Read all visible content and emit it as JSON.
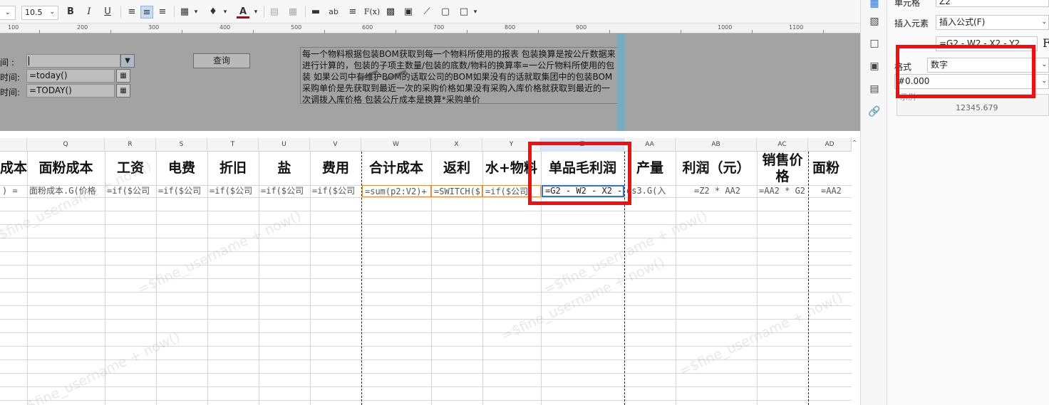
{
  "toolbar": {
    "font_size": "10.5",
    "bold": "B",
    "italic": "I",
    "underline": "U",
    "font_color_glyph": "A",
    "text_glyph": "ab",
    "formula_glyph": "F(x)"
  },
  "ruler": {
    "labels": [
      "100",
      "200",
      "300",
      "400",
      "500",
      "600",
      "700",
      "800",
      "900",
      "1000",
      "1100"
    ]
  },
  "params": {
    "label1": "间 :",
    "label2": "时间:",
    "label3": "时间:",
    "field1": "",
    "field2": "=today()",
    "field3": "=TODAY()",
    "query_button": "查询",
    "description": "每一个物料根据包装BOM获取到每一个物料所使用的报表  包装换算是按公斤数据来进行计算的，包装的子项主数量/包装的底数/物料的换算率=一公斤物料所使用的包装  如果公司中有维护BOM的话取公司的BOM如果没有的话就取集团中的包装BOM  采购单价是先获取到最近一次的采购价格如果没有采购入库价格就获取到最近的一次调拨入库价格  包装公斤成本是换算*采购单价"
  },
  "grid": {
    "columns": [
      {
        "letter": "",
        "header": "成本",
        "formula": ") ="
      },
      {
        "letter": "Q",
        "header": "面粉成本",
        "formula": "面粉成本.G(价格"
      },
      {
        "letter": "R",
        "header": "工资",
        "formula": "=if($公司"
      },
      {
        "letter": "S",
        "header": "电费",
        "formula": "=if($公司"
      },
      {
        "letter": "T",
        "header": "折旧",
        "formula": "=if($公司"
      },
      {
        "letter": "U",
        "header": "盐",
        "formula": "=if($公司"
      },
      {
        "letter": "V",
        "header": "费用",
        "formula": "=if($公司"
      },
      {
        "letter": "W",
        "header": "合计成本",
        "formula": "=sum(p2:V2)+"
      },
      {
        "letter": "X",
        "header": "返利",
        "formula": "=SWITCH($"
      },
      {
        "letter": "Y",
        "header": "水+物料",
        "formula": "=if($公司"
      },
      {
        "letter": "Z",
        "header": "单品毛利润",
        "formula": "=G2 - W2 - X2 -"
      },
      {
        "letter": "AA",
        "header": "产量",
        "formula": "ds3.G(入"
      },
      {
        "letter": "AB",
        "header": "利润（元）",
        "formula": "=Z2 * AA2"
      },
      {
        "letter": "AC",
        "header": "销售价格",
        "formula": "=AA2 * G2"
      },
      {
        "letter": "AD",
        "header": "面粉",
        "formula": "=AA2"
      }
    ],
    "watermark": "=$fine_username + now()"
  },
  "properties": {
    "cell_label": "单元格",
    "cell_value": "Z2",
    "insert_label": "插入元素",
    "insert_value": "插入公式(F)",
    "formula_value": "=G2 - W2 - X2 - Y2",
    "fx_glyph": "F",
    "format_label": "格式",
    "format_value": "数字",
    "pattern_value": "#0.000",
    "sample_label": "示例",
    "sample_value": "12345.679"
  },
  "colors": {
    "highlight": "#ff0a0a",
    "param_bg": "#a3a3a3",
    "selected_cell": "#2f72d8"
  }
}
